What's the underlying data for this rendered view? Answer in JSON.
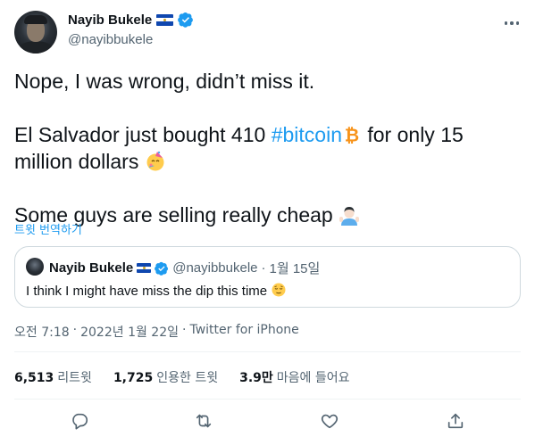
{
  "author": {
    "name": "Nayib Bukele",
    "handle": "@nayibbukele",
    "avatar_icon": "user-avatar",
    "flag_icon": "el-salvador-flag-icon",
    "verified_icon": "verified-badge-icon"
  },
  "tweet": {
    "line1": "Nope, I was wrong, didn’t miss it.",
    "line2_prefix": "El Salvador just bought 410 ",
    "hashtag": "#bitcoin",
    "line2_suffix": "  for only 15",
    "line3": "million dollars ",
    "line4": "Some guys are selling really cheap "
  },
  "translate_label": "트윗 번역하기",
  "quoted": {
    "name": "Nayib Bukele",
    "handle": "@nayibbukele",
    "separator": "·",
    "date": "1월 15일",
    "text": "I think I might have miss the dip this time "
  },
  "meta": {
    "time": "오전 7:18",
    "sep1": "·",
    "date": "2022년 1월 22일",
    "sep2": "·",
    "source": "Twitter for iPhone"
  },
  "stats": {
    "retweets": {
      "count": "6,513",
      "label": "리트윗"
    },
    "quotes": {
      "count": "1,725",
      "label": "인용한 트윗"
    },
    "likes": {
      "count": "3.9만",
      "label": "마음에 들어요"
    }
  },
  "actions": [
    "reply-icon",
    "retweet-icon",
    "like-icon",
    "share-icon"
  ],
  "colors": {
    "accent": "#1d9bf0",
    "text": "#0f1419",
    "muted": "#536471",
    "border": "#cfd9de",
    "bitcoin": "#f7931a"
  }
}
